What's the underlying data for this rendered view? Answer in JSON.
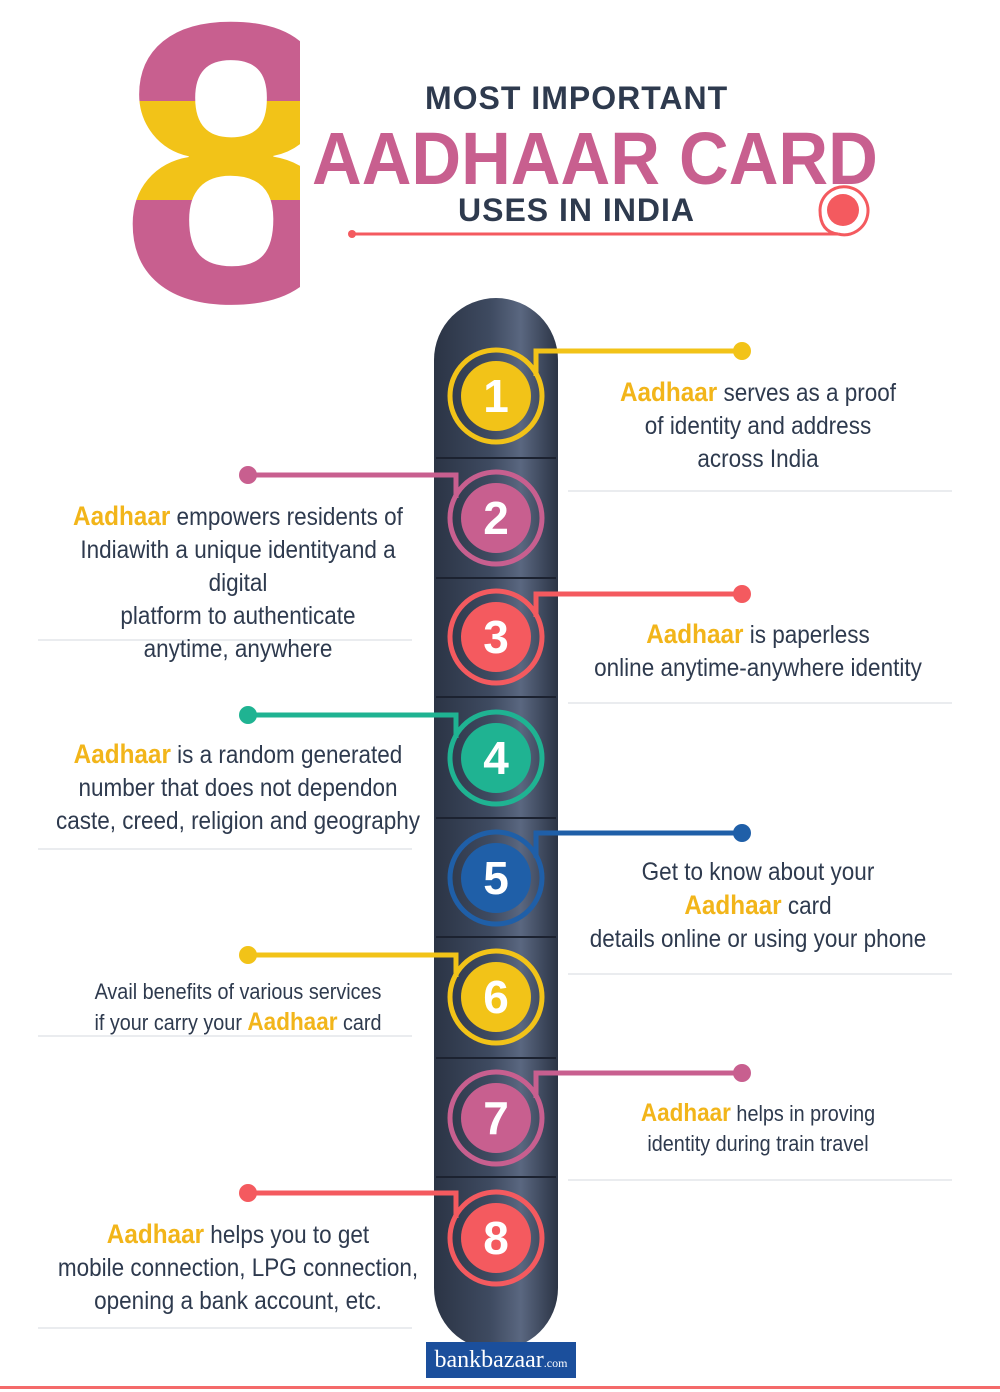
{
  "header": {
    "big_number": "8",
    "line1": "MOST IMPORTANT",
    "line2": "AADHAAR CARD",
    "line3": "USES IN INDIA"
  },
  "colors": {
    "yellow": "#f2c318",
    "magenta": "#c85f8f",
    "red": "#f45a5f",
    "teal": "#1fb392",
    "blue": "#1f5fa8",
    "dark": "#2e3a4e",
    "highlight": "#f2b51a"
  },
  "items": [
    {
      "number": "1",
      "color": "yellow",
      "side": "right",
      "highlight": "Aadhaar",
      "lines": [
        "serves as a proof",
        "of identity and address",
        "across India"
      ]
    },
    {
      "number": "2",
      "color": "magenta",
      "side": "left",
      "highlight": "Aadhaar",
      "lines": [
        "empowers residents of",
        "Indiawith a unique identityand a digital",
        "platform to authenticate",
        "anytime, anywhere"
      ]
    },
    {
      "number": "3",
      "color": "red",
      "side": "right",
      "highlight": "Aadhaar",
      "lines": [
        "is paperless",
        "online anytime-anywhere identity"
      ]
    },
    {
      "number": "4",
      "color": "teal",
      "side": "left",
      "highlight": "Aadhaar",
      "lines": [
        "is a random generated",
        "number that does not dependon",
        "caste, creed, religion and geography"
      ]
    },
    {
      "number": "5",
      "color": "blue",
      "side": "right",
      "highlight": "Aadhaar",
      "lines": [
        "Get to know about your",
        "card",
        "details online or using your phone"
      ]
    },
    {
      "number": "6",
      "color": "yellow",
      "side": "left",
      "highlight": "Aadhaar",
      "lines": [
        "Avail benefits of various services",
        "if your carry your",
        "card"
      ]
    },
    {
      "number": "7",
      "color": "magenta",
      "side": "right",
      "highlight": "Aadhaar",
      "lines": [
        "helps in proving",
        "identity during train travel"
      ]
    },
    {
      "number": "8",
      "color": "red",
      "side": "left",
      "highlight": "Aadhaar",
      "lines": [
        "helps you to get",
        "mobile connection, LPG connection,",
        "opening a bank account, etc."
      ]
    }
  ],
  "footer": {
    "logo_main": "bankbazaar",
    "logo_suffix": ".com"
  }
}
